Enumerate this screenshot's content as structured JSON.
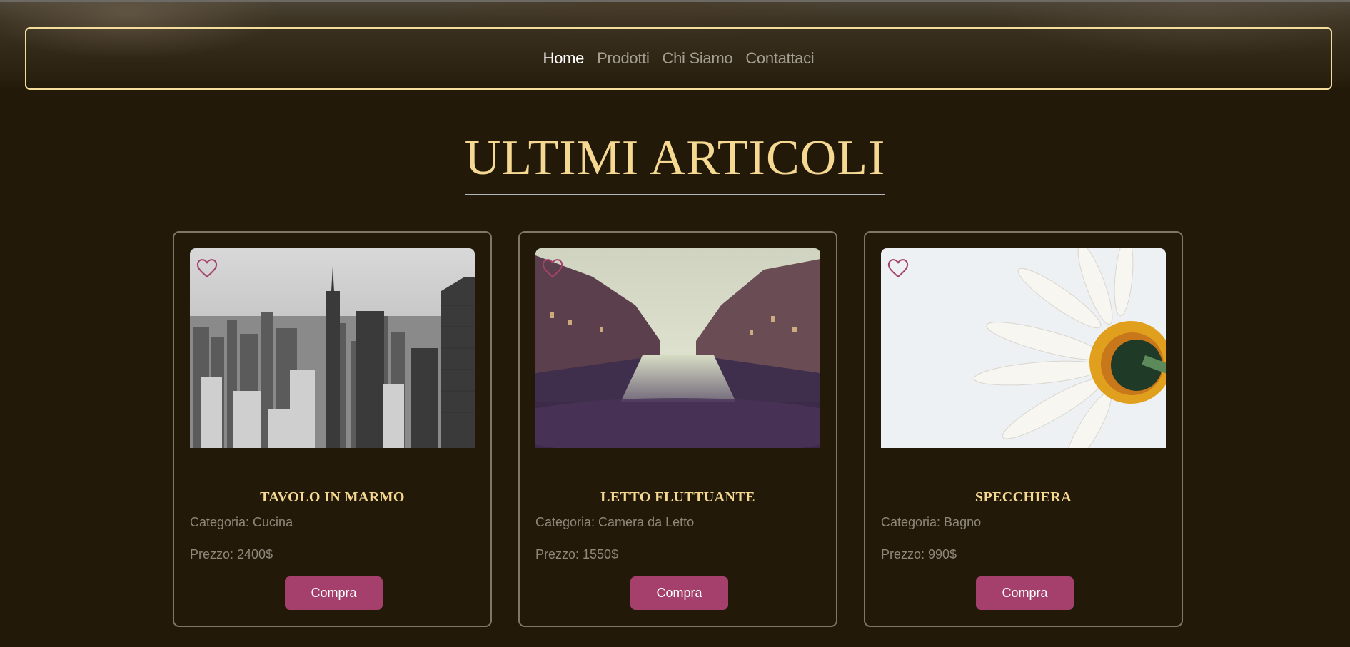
{
  "nav": {
    "links": [
      {
        "label": "Home",
        "active": true
      },
      {
        "label": "Prodotti",
        "active": false
      },
      {
        "label": "Chi Siamo",
        "active": false
      },
      {
        "label": "Contattaci",
        "active": false
      }
    ]
  },
  "section": {
    "title": "ULTIMI ARTICOLI"
  },
  "products": [
    {
      "name": "TAVOLO IN MARMO",
      "category": "Categoria: Cucina",
      "price": "Prezzo: 2400$",
      "buy_label": "Compra",
      "image_icon": "city-skyline-image"
    },
    {
      "name": "LETTO FLUTTUANTE",
      "category": "Categoria: Camera da Letto",
      "price": "Prezzo: 1550$",
      "buy_label": "Compra",
      "image_icon": "canal-city-image"
    },
    {
      "name": "SPECCHIERA",
      "category": "Categoria: Bagno",
      "price": "Prezzo: 990$",
      "buy_label": "Compra",
      "image_icon": "daisy-flower-image"
    }
  ],
  "colors": {
    "background": "#231909",
    "accent_gold": "#f5d891",
    "nav_border": "#f3dc9c",
    "button": "#a5406d",
    "heart": "#a5406d"
  }
}
